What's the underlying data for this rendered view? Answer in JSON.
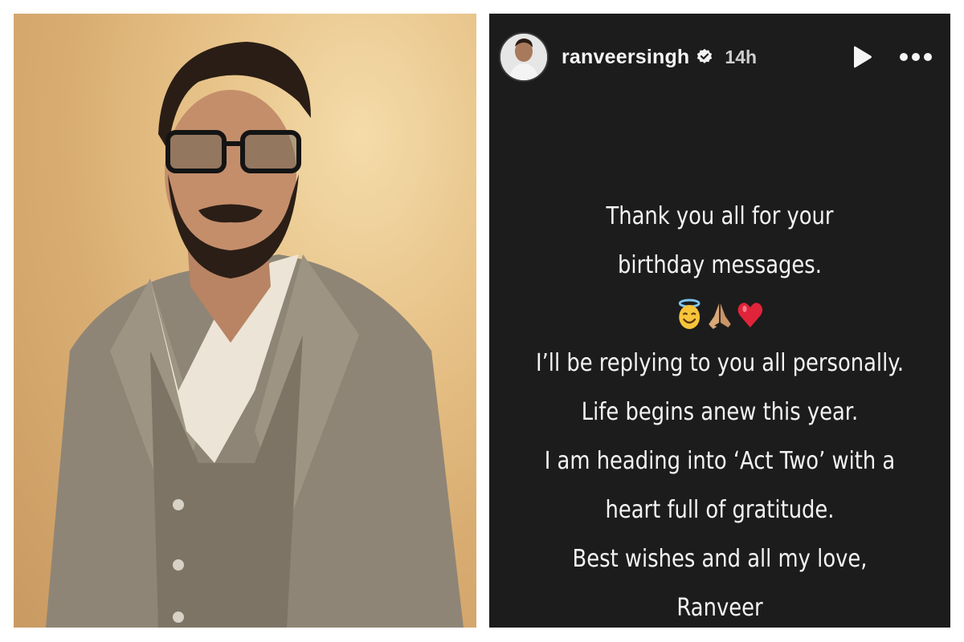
{
  "photo": {
    "description_icon": "portrait-photo"
  },
  "story": {
    "username": "ranveersingh",
    "time": "14h",
    "icons": {
      "verified": "verified-badge-icon",
      "play": "play-icon",
      "more": "more-icon"
    },
    "lines": {
      "l1": "Thank you all for your",
      "l2": "birthday messages.",
      "l3": "I’ll be replying to you all personally.",
      "l4": "Life begins anew this year.",
      "l5": "I am heading into ‘Act Two’ with a",
      "l6": "heart full of gratitude.",
      "l7": "Best wishes and all my love,",
      "l8": "Ranveer"
    },
    "emojis": [
      "smiling-face-with-halo-icon",
      "folded-hands-icon",
      "red-heart-icon"
    ]
  },
  "colors": {
    "story_bg": "#1c1c1c",
    "text": "#f3f3f3",
    "heart": "#e0243a"
  }
}
